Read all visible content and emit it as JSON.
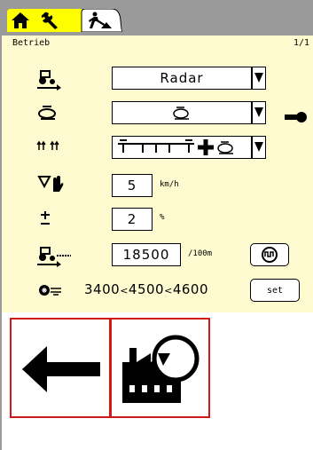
{
  "header": {
    "title": "Betrieb",
    "page_indicator": "1/1"
  },
  "tabs": [
    {
      "name": "home",
      "icon": "home-icon"
    },
    {
      "name": "settings",
      "icon": "wrench-icon"
    },
    {
      "name": "operation",
      "icon": "worker-icon",
      "active": true
    }
  ],
  "rows": {
    "speed_source": {
      "icon": "tractor-speed-icon",
      "value": "Radar"
    },
    "tramline": {
      "icon": "spreader-disc-icon",
      "side_icon": "key-switch-icon"
    },
    "boom": {
      "icon": "boom-sections-icon",
      "value_icons": [
        "boom-icon",
        "plus-icon",
        "spreader-disc-icon"
      ]
    },
    "simulated_speed": {
      "icon": "hand-speed-icon",
      "value": "5",
      "unit": "km/h"
    },
    "quantity_step": {
      "icon": "plus-minus-icon",
      "value": "2",
      "unit": "%"
    },
    "pulses": {
      "icon": "tractor-pulse-icon",
      "value": "18500",
      "unit": "/100m",
      "button_icon": "calibrate-icon"
    },
    "pto": {
      "icon": "pto-icon",
      "min": "3400",
      "current": "4500",
      "max": "4600",
      "sep": "<",
      "button_label": "set"
    }
  },
  "softkeys": [
    {
      "name": "back",
      "icon": "arrow-left-icon"
    },
    {
      "name": "factory-reset",
      "icon": "factory-reset-icon"
    }
  ],
  "colors": {
    "panel": "#fffbd0",
    "topbar": "#9a9a9a",
    "highlight": "#d01a1a"
  }
}
